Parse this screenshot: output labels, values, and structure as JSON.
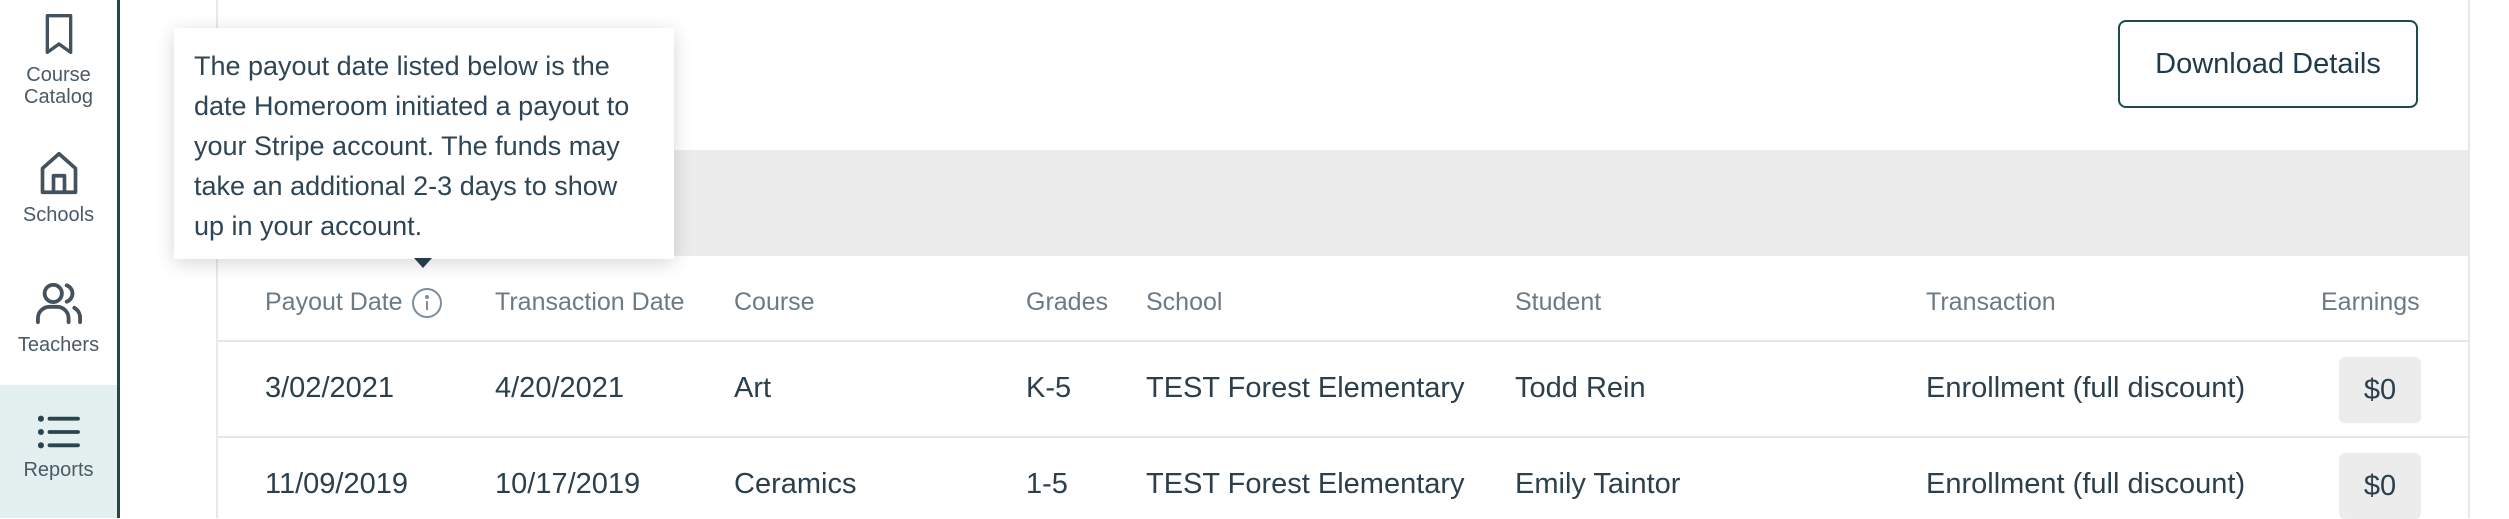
{
  "sidebar": {
    "items": [
      {
        "label_line1": "Course",
        "label_line2": "Catalog",
        "icon": "bookmark-icon"
      },
      {
        "label": "Schools",
        "icon": "home-icon"
      },
      {
        "label": "Teachers",
        "icon": "users-icon"
      },
      {
        "label": "Reports",
        "icon": "list-icon",
        "active": true
      }
    ]
  },
  "toolbar": {
    "download_label": "Download Details"
  },
  "tooltip": {
    "text": "The payout date listed below is the date Homeroom initiated a payout to your Stripe account. The funds may take an additional 2-3 days to show up in your account."
  },
  "table": {
    "headers": {
      "payout_date": "Payout Date",
      "transaction_date": "Transaction Date",
      "course": "Course",
      "grades": "Grades",
      "school": "School",
      "student": "Student",
      "transaction": "Transaction",
      "earnings": "Earnings"
    },
    "rows": [
      {
        "payout_date": "3/02/2021",
        "transaction_date": "4/20/2021",
        "course": "Art",
        "grades": "K-5",
        "school": "TEST Forest Elementary",
        "student": "Todd Rein",
        "transaction": "Enrollment (full discount)",
        "earnings": "$0"
      },
      {
        "payout_date": "11/09/2019",
        "transaction_date": "10/17/2019",
        "course": "Ceramics",
        "grades": "1-5",
        "school": "TEST Forest Elementary",
        "student": "Emily Taintor",
        "transaction": "Enrollment (full discount)",
        "earnings": "$0"
      }
    ]
  },
  "colors": {
    "accent": "#1f4a4c",
    "active_nav_bg": "#e3f0ef",
    "band": "#ececec"
  }
}
